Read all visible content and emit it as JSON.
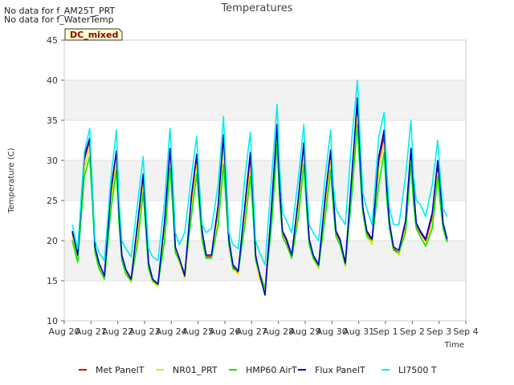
{
  "notices": [
    "No data for f_AM25T_PRT",
    "No data for f_WaterTemp"
  ],
  "badge": "DC_mixed",
  "chart_data": {
    "type": "line",
    "title": "Temperatures",
    "xlabel": "Time",
    "ylabel": "Temperature (C)",
    "ylim": [
      10,
      45
    ],
    "yticks": [
      10,
      15,
      20,
      25,
      30,
      35,
      40,
      45
    ],
    "xlim": [
      0,
      15
    ],
    "xticks": [
      0,
      1,
      2,
      3,
      4,
      5,
      6,
      7,
      8,
      9,
      10,
      11,
      12,
      13,
      14,
      15
    ],
    "xtick_labels": [
      "Aug 20",
      "Aug 21",
      "Aug 22",
      "Aug 23",
      "Aug 24",
      "Aug 25",
      "Aug 26",
      "Aug 27",
      "Aug 28",
      "Aug 29",
      "Aug 30",
      "Aug 31",
      "Sep 1",
      "Sep 2",
      "Sep 3",
      "Sep 4"
    ],
    "grid": true,
    "legend_position": "bottom",
    "series": [
      {
        "name": "Met PanelT",
        "color": "#dd0000",
        "x": [
          0.3,
          0.5,
          0.75,
          0.95,
          1.05,
          1.15,
          1.3,
          1.5,
          1.75,
          1.95,
          2.05,
          2.15,
          2.3,
          2.5,
          2.75,
          2.95,
          3.05,
          3.15,
          3.3,
          3.5,
          3.75,
          3.95,
          4.05,
          4.15,
          4.3,
          4.5,
          4.75,
          4.95,
          5.05,
          5.15,
          5.3,
          5.5,
          5.75,
          5.95,
          6.05,
          6.15,
          6.3,
          6.5,
          6.75,
          6.95,
          7.05,
          7.15,
          7.3,
          7.5,
          7.75,
          7.95,
          8.05,
          8.15,
          8.3,
          8.5,
          8.75,
          8.95,
          9.05,
          9.15,
          9.3,
          9.5,
          9.75,
          9.95,
          10.05,
          10.15,
          10.3,
          10.5,
          10.75,
          10.95,
          11.05,
          11.15,
          11.3,
          11.5,
          11.75,
          11.95,
          12.05,
          12.15,
          12.3,
          12.5,
          12.75,
          12.95,
          13.05,
          13.15,
          13.3,
          13.5,
          13.75,
          13.95,
          14.05,
          14.15,
          14.3
        ],
        "y": [
          21,
          18,
          30,
          32.5,
          26,
          19,
          17,
          15.5,
          26,
          31,
          23,
          18,
          16.2,
          15,
          22,
          28,
          22,
          17,
          15,
          14.5,
          22,
          31,
          26,
          19,
          17.5,
          15.5,
          25,
          30.5,
          25,
          21,
          18,
          18,
          24,
          33,
          26,
          20,
          16.8,
          16,
          24,
          30.5,
          25,
          18,
          15.5,
          14,
          24,
          34,
          26,
          21,
          20,
          18,
          25,
          32,
          25,
          20,
          18,
          16.8,
          25,
          31,
          25,
          21,
          20,
          17,
          28,
          37,
          30,
          24,
          21,
          20,
          30,
          33,
          26,
          22,
          19,
          18.5,
          22,
          31,
          26,
          22,
          21,
          20,
          23,
          29.5,
          26,
          22,
          20
        ]
      },
      {
        "name": "NR01_PRT",
        "color": "#ffdd00",
        "x": [
          0.3,
          0.5,
          0.75,
          0.95,
          1.05,
          1.15,
          1.3,
          1.5,
          1.75,
          1.95,
          2.05,
          2.15,
          2.3,
          2.5,
          2.75,
          2.95,
          3.05,
          3.15,
          3.3,
          3.5,
          3.75,
          3.95,
          4.05,
          4.15,
          4.3,
          4.5,
          4.75,
          4.95,
          5.05,
          5.15,
          5.3,
          5.5,
          5.75,
          5.95,
          6.05,
          6.15,
          6.3,
          6.5,
          6.75,
          6.95,
          7.05,
          7.15,
          7.3,
          7.5,
          7.75,
          7.95,
          8.05,
          8.15,
          8.3,
          8.5,
          8.75,
          8.95,
          9.05,
          9.15,
          9.3,
          9.5,
          9.75,
          9.95,
          10.05,
          10.15,
          10.3,
          10.5,
          10.75,
          10.95,
          11.05,
          11.15,
          11.3,
          11.5,
          11.75,
          11.95,
          12.05,
          12.15,
          12.3,
          12.5,
          12.75,
          12.95,
          13.05,
          13.15,
          13.3,
          13.5,
          13.75,
          13.95,
          14.05,
          14.15,
          14.3
        ],
        "y": [
          20.5,
          17.8,
          29,
          31.5,
          25.5,
          18.8,
          16.8,
          15.3,
          25,
          30,
          22.5,
          17.8,
          16,
          14.8,
          21,
          27,
          21.5,
          16.8,
          14.8,
          14.3,
          21,
          30,
          25,
          18.8,
          17.3,
          15.3,
          24,
          29.5,
          24.5,
          20.5,
          17.8,
          17.8,
          23,
          31.5,
          25,
          19.5,
          16.5,
          15.8,
          23,
          29,
          24,
          17.5,
          15.2,
          13.8,
          23,
          33,
          25,
          20.5,
          19.5,
          17.8,
          24,
          31,
          24.5,
          19.5,
          17.8,
          16.5,
          24,
          30,
          24.5,
          20.5,
          19.5,
          16.8,
          27,
          35.5,
          29,
          23.5,
          20.5,
          19.5,
          29,
          32,
          25.5,
          21.5,
          18.8,
          18.2,
          21.5,
          30,
          25,
          21.5,
          20.5,
          19.5,
          22,
          28.5,
          25,
          21.5,
          19.8
        ]
      },
      {
        "name": "HMP60 AirT",
        "color": "#00ee00",
        "x": [
          0.3,
          0.5,
          0.75,
          0.95,
          1.05,
          1.15,
          1.3,
          1.5,
          1.75,
          1.95,
          2.05,
          2.15,
          2.3,
          2.5,
          2.75,
          2.95,
          3.05,
          3.15,
          3.3,
          3.5,
          3.75,
          3.95,
          4.05,
          4.15,
          4.3,
          4.5,
          4.75,
          4.95,
          5.05,
          5.15,
          5.3,
          5.5,
          5.75,
          5.95,
          6.05,
          6.15,
          6.3,
          6.5,
          6.75,
          6.95,
          7.05,
          7.15,
          7.3,
          7.5,
          7.75,
          7.95,
          8.05,
          8.15,
          8.3,
          8.5,
          8.75,
          8.95,
          9.05,
          9.15,
          9.3,
          9.5,
          9.75,
          9.95,
          10.05,
          10.15,
          10.3,
          10.5,
          10.75,
          10.95,
          11.05,
          11.15,
          11.3,
          11.5,
          11.75,
          11.95,
          12.05,
          12.15,
          12.3,
          12.5,
          12.75,
          12.95,
          13.05,
          13.15,
          13.3,
          13.5,
          13.75,
          13.95,
          14.05,
          14.15,
          14.3
        ],
        "y": [
          20,
          17.3,
          28,
          30.5,
          25,
          18.5,
          16.5,
          15.2,
          24,
          28.8,
          22,
          17.5,
          15.8,
          15,
          20,
          26,
          21,
          16.5,
          15,
          14.5,
          20,
          29,
          24.5,
          18.5,
          17.5,
          16,
          23,
          28.3,
          24,
          20,
          17.8,
          17.8,
          22,
          29.5,
          24.5,
          19.5,
          16.5,
          16.2,
          22,
          28,
          23.5,
          17.5,
          16,
          14,
          22,
          32,
          25,
          20.5,
          19.5,
          17.8,
          23,
          29.5,
          24,
          19.5,
          17.8,
          16.8,
          23,
          28.8,
          24,
          20.5,
          19.5,
          17,
          26,
          34.5,
          28.5,
          23.5,
          20.5,
          20,
          27,
          31,
          25,
          21.5,
          18.8,
          18.5,
          21,
          29.5,
          24.5,
          21.5,
          20.5,
          19.3,
          21.5,
          28,
          24.5,
          21.5,
          19.8
        ]
      },
      {
        "name": "Flux PanelT",
        "color": "#0000cc",
        "x": [
          0.3,
          0.5,
          0.75,
          0.95,
          1.05,
          1.15,
          1.3,
          1.5,
          1.75,
          1.95,
          2.05,
          2.15,
          2.3,
          2.5,
          2.75,
          2.95,
          3.05,
          3.15,
          3.3,
          3.5,
          3.75,
          3.95,
          4.05,
          4.15,
          4.3,
          4.5,
          4.75,
          4.95,
          5.05,
          5.15,
          5.3,
          5.5,
          5.75,
          5.95,
          6.05,
          6.15,
          6.3,
          6.5,
          6.75,
          6.95,
          7.05,
          7.15,
          7.3,
          7.5,
          7.75,
          7.95,
          8.05,
          8.15,
          8.3,
          8.5,
          8.75,
          8.95,
          9.05,
          9.15,
          9.3,
          9.5,
          9.75,
          9.95,
          10.05,
          10.15,
          10.3,
          10.5,
          10.75,
          10.95,
          11.05,
          11.15,
          11.3,
          11.5,
          11.75,
          11.95,
          12.05,
          12.15,
          12.3,
          12.5,
          12.75,
          12.95,
          13.05,
          13.15,
          13.3,
          13.5,
          13.75,
          13.95,
          14.05,
          14.15,
          14.3
        ],
        "y": [
          21.2,
          18.2,
          30.5,
          32.8,
          26.5,
          19.2,
          17.2,
          15.6,
          26.5,
          31.2,
          23.5,
          18.2,
          16.4,
          15.2,
          22.5,
          28.3,
          22.5,
          17.2,
          15.2,
          14.6,
          22.5,
          31.5,
          26.5,
          19.2,
          17.8,
          15.6,
          25.5,
          30.8,
          25.5,
          21.2,
          18.2,
          18.2,
          24.5,
          33.2,
          26.5,
          20.2,
          17,
          16.2,
          24.5,
          31,
          25.5,
          18.2,
          15.8,
          13.2,
          24.5,
          34.5,
          26.5,
          21.2,
          20.2,
          18.2,
          25.5,
          32.2,
          25.5,
          20.2,
          18.2,
          17,
          25.5,
          31.3,
          25.5,
          21.2,
          20.2,
          17.2,
          28.5,
          37.8,
          30.5,
          24.2,
          21.2,
          20.2,
          30.5,
          33.8,
          26.5,
          22.2,
          19.2,
          18.8,
          22.5,
          31.5,
          26.5,
          22.2,
          21.2,
          20.2,
          23.5,
          30,
          26.5,
          22.2,
          20.2
        ]
      },
      {
        "name": "LI7500 T",
        "color": "#00eeee",
        "x": [
          0.3,
          0.5,
          0.75,
          0.95,
          1.05,
          1.15,
          1.3,
          1.5,
          1.75,
          1.95,
          2.05,
          2.15,
          2.3,
          2.5,
          2.75,
          2.95,
          3.05,
          3.15,
          3.3,
          3.5,
          3.75,
          3.95,
          4.05,
          4.15,
          4.3,
          4.5,
          4.75,
          4.95,
          5.05,
          5.15,
          5.3,
          5.5,
          5.75,
          5.95,
          6.05,
          6.15,
          6.3,
          6.5,
          6.75,
          6.95,
          7.05,
          7.15,
          7.3,
          7.5,
          7.75,
          7.95,
          8.05,
          8.15,
          8.3,
          8.5,
          8.75,
          8.95,
          9.05,
          9.15,
          9.3,
          9.5,
          9.75,
          9.95,
          10.05,
          10.15,
          10.3,
          10.5,
          10.75,
          10.95,
          11.05,
          11.15,
          11.3,
          11.5,
          11.75,
          11.95,
          12.05,
          12.15,
          12.3,
          12.5,
          12.75,
          12.95,
          13.05,
          13.15,
          13.3,
          13.5,
          13.75,
          13.95,
          14.05,
          14.15,
          14.3
        ],
        "y": [
          22,
          19,
          31,
          34,
          27,
          20,
          18.5,
          17.5,
          28,
          33.8,
          25,
          20,
          19,
          18,
          25,
          30.5,
          24,
          19,
          18,
          17.5,
          25,
          34,
          28,
          21,
          19.5,
          21,
          28,
          33,
          27,
          22,
          21,
          21.5,
          27,
          35.5,
          28,
          21,
          19.5,
          19,
          28,
          33.5,
          27,
          20,
          18.5,
          17,
          28,
          37,
          29,
          23.5,
          22.5,
          21,
          28,
          34.5,
          27,
          22,
          21,
          20,
          28,
          33.8,
          27,
          24,
          23,
          22,
          33,
          40,
          33,
          26,
          24,
          22,
          33,
          36,
          28.5,
          24,
          22,
          22,
          28,
          35,
          28,
          25,
          24.5,
          23,
          27,
          32.5,
          28,
          24,
          23
        ]
      }
    ]
  }
}
